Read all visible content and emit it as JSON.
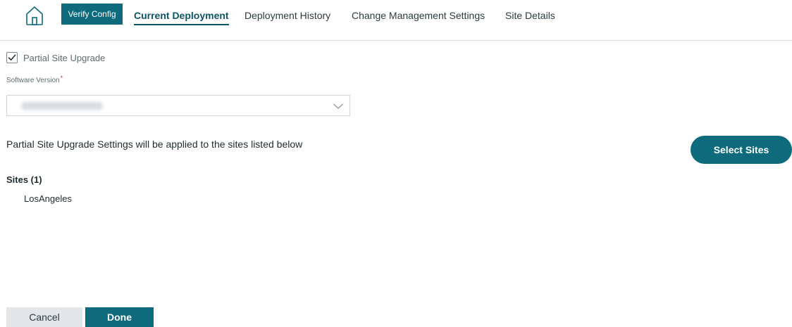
{
  "header": {
    "home_icon": "home-icon",
    "verify_button": "Verify Config",
    "tabs": [
      {
        "label": "Current Deployment",
        "active": true
      },
      {
        "label": "Deployment History",
        "active": false
      },
      {
        "label": "Change Management Settings",
        "active": false
      },
      {
        "label": "Site Details",
        "active": false
      }
    ]
  },
  "form": {
    "partial_upgrade": {
      "label": "Partial Site Upgrade",
      "checked": true,
      "icon": "checkmark-icon"
    },
    "software_version": {
      "label": "Software Version",
      "required_mark": "*",
      "dropdown_icon": "chevron-down-icon"
    }
  },
  "sites_section": {
    "info": "Partial Site Upgrade Settings will be applied to the sites listed below",
    "select_button": "Select Sites",
    "heading": "Sites (1)",
    "items": [
      "LosAngeles"
    ]
  },
  "footer": {
    "cancel": "Cancel",
    "done": "Done"
  },
  "colors": {
    "accent": "#0e6b7c",
    "active_tab": "#0c5566"
  }
}
